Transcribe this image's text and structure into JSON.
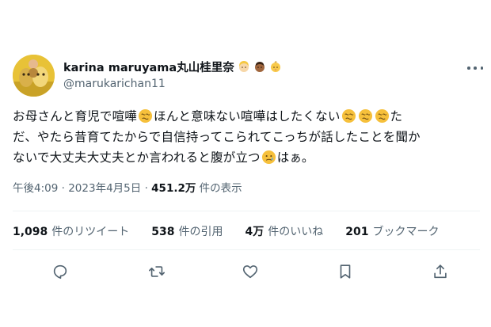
{
  "user": {
    "display_name": "karina maruyama丸山桂里奈",
    "handle": "@marukarichan11",
    "badges": [
      "blonde-person-emoji",
      "man-medium-dark-skin-emoji",
      "baby-emoji"
    ]
  },
  "tweet": {
    "lines": [
      [
        "お母さんと育児で喧嘩",
        "ほんと意味ない喧嘩はしたくない",
        "た"
      ],
      [
        "だ、やたら昔育てたからで自信持ってこられてこっちが話したことを聞か"
      ],
      [
        "ないで大丈夫大丈夫とか言われると腹が立つ",
        "はぁ。"
      ]
    ],
    "emojis": [
      "woozy-face-emoji",
      "face-holding-back-tears-emoji"
    ]
  },
  "meta": {
    "time": "午後4:09",
    "sep1": "·",
    "date": "2023年4月5日",
    "sep2": "·",
    "views_count": "451.2万",
    "views_label": "件の表示"
  },
  "stats": {
    "retweets": {
      "count": "1,098",
      "label": "件のリツイート"
    },
    "quotes": {
      "count": "538",
      "label": "件の引用"
    },
    "likes": {
      "count": "4万",
      "label": "件のいいね"
    },
    "bookmarks": {
      "count": "201",
      "label": "ブックマーク"
    }
  },
  "actions": [
    "reply-icon",
    "retweet-icon",
    "like-icon",
    "bookmark-icon",
    "share-icon"
  ],
  "colors": {
    "text": "#0f1419",
    "muted": "#536471",
    "divider": "#eff3f4",
    "emoji_yellow": "#f6c03b"
  }
}
